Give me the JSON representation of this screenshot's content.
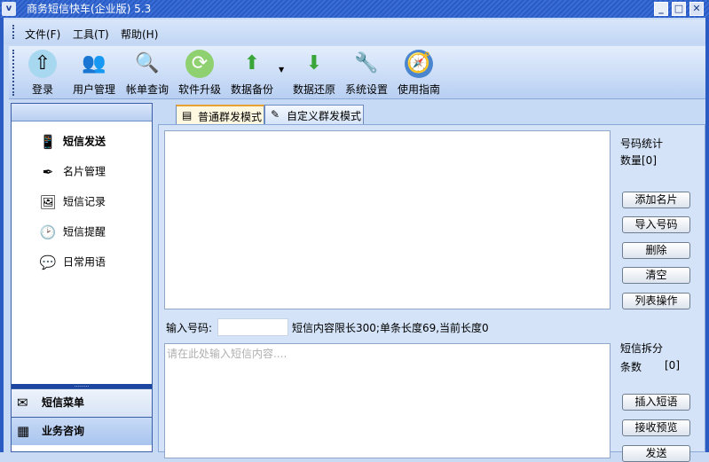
{
  "window": {
    "title": "商务短信快车(企业版) 5.3"
  },
  "menu": [
    "文件(F)",
    "工具(T)",
    "帮助(H)"
  ],
  "toolbar": [
    {
      "label": "登录",
      "icon": "login-icon"
    },
    {
      "label": "用户管理",
      "icon": "users-icon"
    },
    {
      "label": "帐单查询",
      "icon": "search-bill-icon"
    },
    {
      "label": "软件升级",
      "icon": "upgrade-icon"
    },
    {
      "label": "数据备份",
      "icon": "backup-icon"
    },
    {
      "label": "数据还原",
      "icon": "restore-icon"
    },
    {
      "label": "系统设置",
      "icon": "settings-icon"
    },
    {
      "label": "使用指南",
      "icon": "compass-icon"
    }
  ],
  "sidebar": {
    "items": [
      {
        "label": "短信发送"
      },
      {
        "label": "名片管理"
      },
      {
        "label": "短信记录"
      },
      {
        "label": "短信提醒"
      },
      {
        "label": "日常用语"
      }
    ],
    "bars": [
      {
        "label": "短信菜单"
      },
      {
        "label": "业务咨询"
      }
    ]
  },
  "tabs": [
    {
      "label": "普通群发模式"
    },
    {
      "label": "自定义群发模式"
    }
  ],
  "numbers": {
    "stat_label": "号码统计",
    "count_label": "数量[0]",
    "buttons": [
      "添加名片",
      "导入号码",
      "删除",
      "清空",
      "列表操作"
    ]
  },
  "input": {
    "label": "输入号码:",
    "value": "",
    "info": "短信内容限长300;单条长度69,当前长度0"
  },
  "message": {
    "placeholder": "请在此处输入短信内容....",
    "split_label": "短信拆分",
    "count_label": "条数",
    "count_value": "[0]",
    "buttons": [
      "插入短语",
      "接收预览",
      "发送"
    ]
  }
}
